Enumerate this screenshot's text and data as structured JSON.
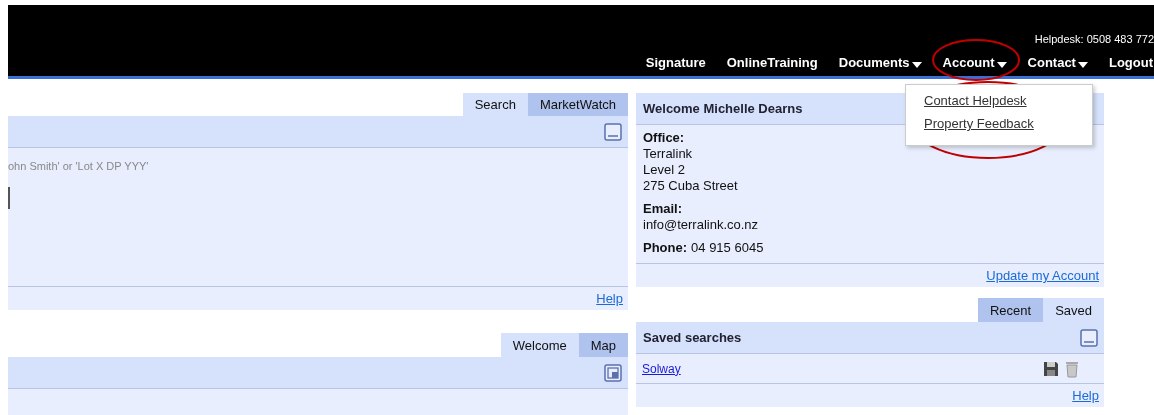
{
  "header": {
    "helpdesk": "Helpdesk: 0508 483 772",
    "nav": [
      {
        "label": "Signature",
        "dropdown": false,
        "highlighted": false
      },
      {
        "label": "OnlineTraining",
        "dropdown": false,
        "highlighted": false
      },
      {
        "label": "Documents",
        "dropdown": true,
        "highlighted": false
      },
      {
        "label": "Account",
        "dropdown": true,
        "highlighted": true
      },
      {
        "label": "Contact",
        "dropdown": true,
        "highlighted": false
      },
      {
        "label": "Logout",
        "dropdown": false,
        "highlighted": false
      }
    ]
  },
  "account_menu": {
    "highlighted": true,
    "items": [
      "Contact Helpdesk",
      "Property Feedback"
    ]
  },
  "search_panel": {
    "tabs": [
      {
        "label": "Search",
        "selected": true
      },
      {
        "label": "MarketWatch",
        "selected": false
      }
    ],
    "hint": "ohn Smith' or 'Lot X DP YYY'",
    "help": "Help"
  },
  "map_panel": {
    "tabs": [
      {
        "label": "Welcome",
        "selected": true
      },
      {
        "label": "Map",
        "selected": false
      }
    ]
  },
  "welcome_panel": {
    "title": "Welcome Michelle Dearns",
    "office_label": "Office:",
    "office_lines": [
      "Terralink",
      "Level 2",
      "275 Cuba Street"
    ],
    "email_label": "Email:",
    "email": "info@terralink.co.nz",
    "phone_label": "Phone:",
    "phone": "04 915 6045",
    "update_link": "Update my Account"
  },
  "saved_panel": {
    "tabs": [
      {
        "label": "Recent",
        "selected": false
      },
      {
        "label": "Saved",
        "selected": true
      }
    ],
    "title": "Saved searches",
    "rows": [
      {
        "name": "Solway"
      }
    ],
    "help": "Help"
  }
}
